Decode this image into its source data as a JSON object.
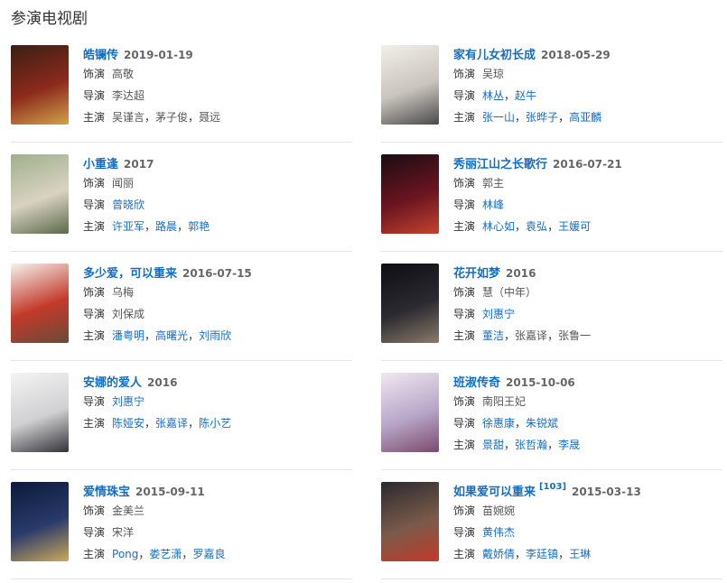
{
  "section": {
    "title": "参演电视剧"
  },
  "labels": {
    "role": "饰演",
    "director": "导演",
    "cast": "主演"
  },
  "colors": {
    "link": "#136ec2",
    "divider": "#e6e6e6"
  },
  "items": [
    {
      "title": "皓镧传",
      "date": "2019-01-19",
      "ref": "",
      "role": "高敬",
      "directors": [
        {
          "name": "李达超",
          "link": false
        }
      ],
      "cast": [
        {
          "name": "吴谨言",
          "link": false
        },
        {
          "name": "茅子俊",
          "link": false
        },
        {
          "name": "聂远",
          "link": false
        }
      ]
    },
    {
      "title": "家有儿女初长成",
      "date": "2018-05-29",
      "ref": "",
      "role": "吴琼",
      "directors": [
        {
          "name": "林丛",
          "link": true
        },
        {
          "name": "赵牛",
          "link": true
        }
      ],
      "cast": [
        {
          "name": "张一山",
          "link": true
        },
        {
          "name": "张晔子",
          "link": true
        },
        {
          "name": "高亚麟",
          "link": true
        }
      ]
    },
    {
      "title": "小重逢",
      "date": "2017",
      "ref": "",
      "role": "闻丽",
      "directors": [
        {
          "name": "曾晓欣",
          "link": true
        }
      ],
      "cast": [
        {
          "name": "许亚军",
          "link": true
        },
        {
          "name": "路晨",
          "link": true
        },
        {
          "name": "郭艳",
          "link": true
        }
      ]
    },
    {
      "title": "秀丽江山之长歌行",
      "date": "2016-07-21",
      "ref": "",
      "role": "郭主",
      "directors": [
        {
          "name": "林峰",
          "link": true
        }
      ],
      "cast": [
        {
          "name": "林心如",
          "link": true
        },
        {
          "name": "袁弘",
          "link": true
        },
        {
          "name": "王媛可",
          "link": true
        }
      ]
    },
    {
      "title": "多少爱，可以重来",
      "date": "2016-07-15",
      "ref": "",
      "role": "乌梅",
      "directors": [
        {
          "name": "刘保成",
          "link": false
        }
      ],
      "cast": [
        {
          "name": "潘粤明",
          "link": true
        },
        {
          "name": "高曙光",
          "link": true
        },
        {
          "name": "刘雨欣",
          "link": true
        }
      ]
    },
    {
      "title": "花开如梦",
      "date": "2016",
      "ref": "",
      "role": "慧（中年）",
      "directors": [
        {
          "name": "刘惠宁",
          "link": true
        }
      ],
      "cast": [
        {
          "name": "董洁",
          "link": true
        },
        {
          "name": "张嘉译",
          "link": false
        },
        {
          "name": "张鲁一",
          "link": false
        }
      ]
    },
    {
      "title": "安娜的爱人",
      "date": "2016",
      "ref": "",
      "role": "",
      "directors": [
        {
          "name": "刘惠宁",
          "link": true
        }
      ],
      "cast": [
        {
          "name": "陈娅安",
          "link": true
        },
        {
          "name": "张嘉译",
          "link": true
        },
        {
          "name": "陈小艺",
          "link": true
        }
      ]
    },
    {
      "title": "班淑传奇",
      "date": "2015-10-06",
      "ref": "",
      "role": "南阳王妃",
      "directors": [
        {
          "name": "徐惠康",
          "link": true
        },
        {
          "name": "朱锐斌",
          "link": true
        }
      ],
      "cast": [
        {
          "name": "景甜",
          "link": true
        },
        {
          "name": "张哲瀚",
          "link": true
        },
        {
          "name": "李晟",
          "link": true
        }
      ]
    },
    {
      "title": "爱情珠宝",
      "date": "2015-09-11",
      "ref": "",
      "role": "金美兰",
      "directors": [
        {
          "name": "宋洋",
          "link": false
        }
      ],
      "cast": [
        {
          "name": "Pong",
          "link": true
        },
        {
          "name": "娄艺潇",
          "link": true
        },
        {
          "name": "罗嘉良",
          "link": true
        }
      ]
    },
    {
      "title": "如果爱可以重来",
      "date": "2015-03-13",
      "ref": "[103]",
      "role": "苗婉婉",
      "directors": [
        {
          "name": "黄伟杰",
          "link": true
        }
      ],
      "cast": [
        {
          "name": "戴娇倩",
          "link": true
        },
        {
          "name": "李廷镇",
          "link": true
        },
        {
          "name": "王琳",
          "link": true
        }
      ]
    }
  ]
}
